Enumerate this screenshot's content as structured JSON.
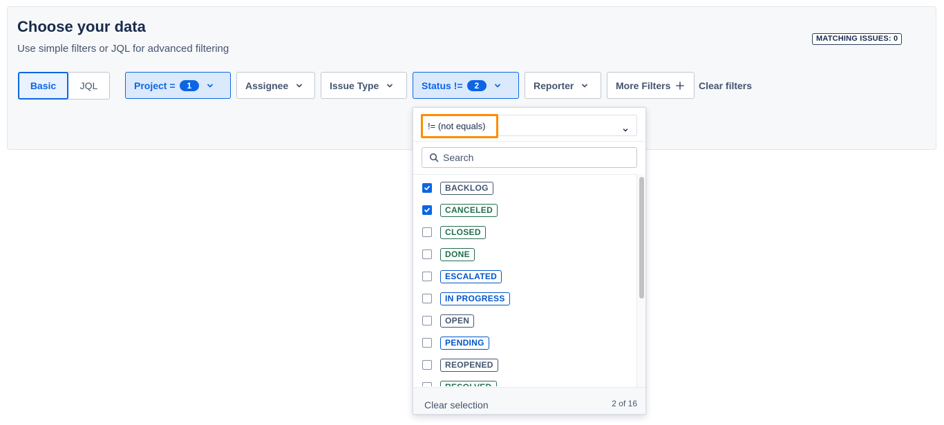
{
  "header": {
    "title": "Choose your data",
    "subtitle": "Use simple filters or JQL for advanced filtering",
    "matching_issues": "MATCHING ISSUES: 0"
  },
  "mode_toggle": {
    "basic": "Basic",
    "jql": "JQL",
    "active": "Basic"
  },
  "filters": {
    "project_label": "Project =",
    "project_count": "1",
    "assignee_label": "Assignee",
    "issue_type_label": "Issue Type",
    "status_label": "Status !=",
    "status_count": "2",
    "reporter_label": "Reporter",
    "more_filters_label": "More Filters",
    "clear_filters_label": "Clear filters"
  },
  "status_dropdown": {
    "operator": "!= (not equals)",
    "search_placeholder": "Search",
    "options": [
      {
        "label": "BACKLOG",
        "checked": true,
        "color": "#44546f"
      },
      {
        "label": "CANCELED",
        "checked": true,
        "color": "#216e4e"
      },
      {
        "label": "CLOSED",
        "checked": false,
        "color": "#216e4e"
      },
      {
        "label": "DONE",
        "checked": false,
        "color": "#216e4e"
      },
      {
        "label": "ESCALATED",
        "checked": false,
        "color": "#0055cc"
      },
      {
        "label": "IN PROGRESS",
        "checked": false,
        "color": "#0055cc"
      },
      {
        "label": "OPEN",
        "checked": false,
        "color": "#44546f"
      },
      {
        "label": "PENDING",
        "checked": false,
        "color": "#0055cc"
      },
      {
        "label": "REOPENED",
        "checked": false,
        "color": "#44546f"
      },
      {
        "label": "RESOLVED",
        "checked": false,
        "color": "#216e4e"
      }
    ],
    "clear_selection_label": "Clear selection",
    "selection_count": "2 of 16"
  },
  "colors": {
    "accent": "#0c66e4",
    "highlight": "#ff8b00"
  }
}
